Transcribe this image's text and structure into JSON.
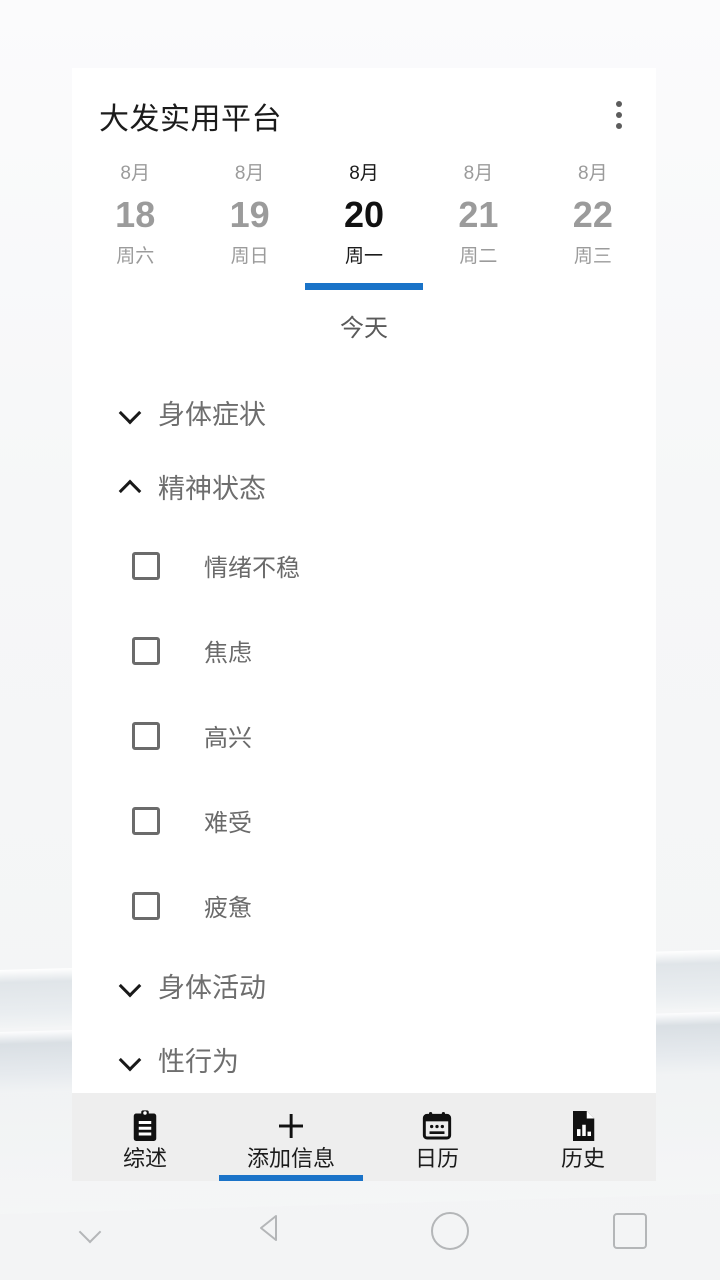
{
  "app": {
    "title": "大发实用平台",
    "overflow_menu_icon": "more-vertical-icon",
    "accent_color": "#1a73c8"
  },
  "date_strip": {
    "today_label": "今天",
    "days": [
      {
        "month": "8月",
        "day": "18",
        "weekday": "周六",
        "selected": false
      },
      {
        "month": "8月",
        "day": "19",
        "weekday": "周日",
        "selected": false
      },
      {
        "month": "8月",
        "day": "20",
        "weekday": "周一",
        "selected": true
      },
      {
        "month": "8月",
        "day": "21",
        "weekday": "周二",
        "selected": false
      },
      {
        "month": "8月",
        "day": "22",
        "weekday": "周三",
        "selected": false
      }
    ]
  },
  "sections": [
    {
      "label": "身体症状",
      "expanded": false,
      "chevron_icon": "chevron-down-icon",
      "items": []
    },
    {
      "label": "精神状态",
      "expanded": true,
      "chevron_icon": "chevron-up-icon",
      "items": [
        {
          "label": "情绪不稳",
          "checked": false
        },
        {
          "label": "焦虑",
          "checked": false
        },
        {
          "label": "高兴",
          "checked": false
        },
        {
          "label": "难受",
          "checked": false
        },
        {
          "label": "疲惫",
          "checked": false
        }
      ]
    },
    {
      "label": "身体活动",
      "expanded": false,
      "chevron_icon": "chevron-down-icon",
      "items": []
    },
    {
      "label": "性行为",
      "expanded": false,
      "chevron_icon": "chevron-down-icon",
      "items": []
    }
  ],
  "tab_bar": {
    "tabs": [
      {
        "label": "综述",
        "icon": "clipboard-icon",
        "active": false
      },
      {
        "label": "添加信息",
        "icon": "plus-icon",
        "active": true
      },
      {
        "label": "日历",
        "icon": "calendar-icon",
        "active": false
      },
      {
        "label": "历史",
        "icon": "chart-document-icon",
        "active": false
      }
    ]
  },
  "system_nav": {
    "buttons": [
      {
        "icon": "chevron-down-icon",
        "name": "hide-keyboard-button"
      },
      {
        "icon": "triangle-back-icon",
        "name": "back-button"
      },
      {
        "icon": "circle-home-icon",
        "name": "home-button"
      },
      {
        "icon": "square-recents-icon",
        "name": "recents-button"
      }
    ]
  }
}
